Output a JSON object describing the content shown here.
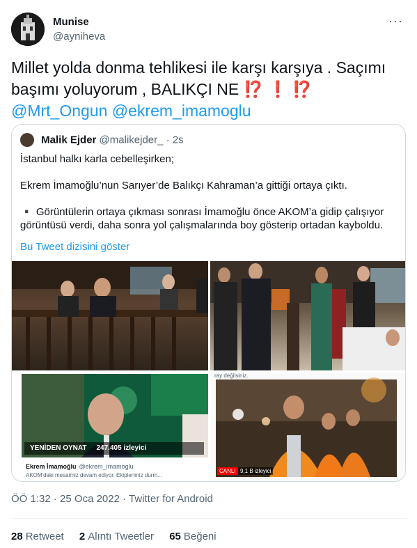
{
  "author": {
    "name": "Munise",
    "handle": "@ayniheva",
    "more_label": "···"
  },
  "tweet": {
    "text_part1": "Millet yolda donma tehlikesi ile karşı karşıya . Saçımı başımı yoluyorum , BALIKÇI NE ",
    "emoji_marks": "⁉️ ❗ ⁉️",
    "mention1": "@Mrt_Ongun",
    "mention2": "@ekrem_imamoglu"
  },
  "quote": {
    "name": "Malik Ejder",
    "handle": "@malikejder_",
    "time": "· 2s",
    "para1": "İstanbul halkı karla cebelleşirken;",
    "para2": "Ekrem İmamoğlu’nun Sarıyer’de Balıkçı Kahraman’a gittiği ortaya çıktı.",
    "para3": "▪️ Görüntülerin ortaya çıkması sonrası İmamoğlu önce AKOM’a gidip çalışıyor görüntüsü verdi, daha sonra yol çalışmalarında boy gösterip ortadan kayboldu.",
    "show_thread": "Bu Tweet dizisini göster",
    "media": {
      "replay_label": "YENİDEN OYNAT",
      "viewers_label": "247.405 izleyici",
      "embed_name": "Ekrem İmamoğlu",
      "embed_handle": "@ekrem_imamoglu",
      "embed_snippet": "AKOM'daki mesaimiz devam ediyor. Ekiplerimiz durm...",
      "live_tag": "CANLI",
      "live_viewers": "9,1 B izleyici",
      "top_text": "ray değilsiniz."
    }
  },
  "meta": {
    "time": "ÖÖ 1:32",
    "date": "25 Oca 2022",
    "source": "Twitter for Android"
  },
  "stats": {
    "retweets_count": "28",
    "retweets_label": "Retweet",
    "quotes_count": "2",
    "quotes_label": "Alıntı Tweetler",
    "likes_count": "65",
    "likes_label": "Beğeni"
  }
}
